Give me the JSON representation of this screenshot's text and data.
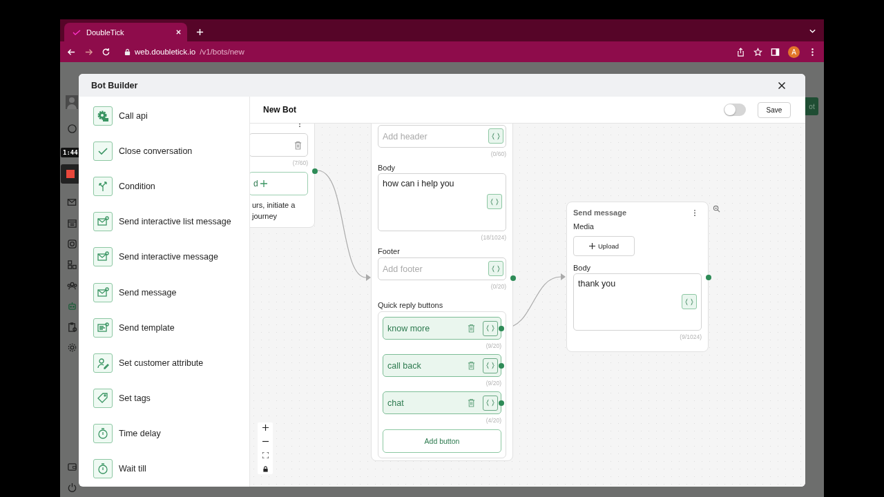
{
  "browser": {
    "tab_title": "DoubleTick",
    "url_host": "web.doubletick.io",
    "url_path": "/v1/bots/new",
    "profile_initial": "A"
  },
  "recording": {
    "time": "1:44"
  },
  "background": {
    "button_fragment": "ot"
  },
  "modal": {
    "title": "Bot Builder"
  },
  "sidebar": {
    "items": [
      {
        "label": "Call api",
        "kind": "api"
      },
      {
        "label": "Close conversation",
        "kind": "check"
      },
      {
        "label": "Condition",
        "kind": "branch"
      },
      {
        "label": "Send interactive list message",
        "kind": "mail-dot"
      },
      {
        "label": "Send interactive message",
        "kind": "mail-dot"
      },
      {
        "label": "Send message",
        "kind": "mail"
      },
      {
        "label": "Send template",
        "kind": "template"
      },
      {
        "label": "Set customer attribute",
        "kind": "person"
      },
      {
        "label": "Set tags",
        "kind": "tag"
      },
      {
        "label": "Time delay",
        "kind": "timer"
      },
      {
        "label": "Wait till",
        "kind": "timer"
      }
    ]
  },
  "editor": {
    "title": "New Bot",
    "toggle": {
      "on": false
    },
    "save": "Save"
  },
  "left_node": {
    "counter": "(7/60)",
    "button_fragment": "d",
    "text_lines": [
      "urs, initiate a",
      "journey"
    ]
  },
  "question_node": {
    "header_placeholder": "Add header",
    "header_counter": "(0/60)",
    "body_label": "Body",
    "body_value": "how can i help you",
    "body_counter": "(18/1024)",
    "footer_label": "Footer",
    "footer_placeholder": "Add footer",
    "footer_counter": "(0/20)",
    "buttons_label": "Quick reply buttons",
    "buttons": [
      {
        "label": "know more",
        "counter": "(9/20)"
      },
      {
        "label": "call back",
        "counter": "(9/20)"
      },
      {
        "label": "chat",
        "counter": "(4/20)"
      }
    ],
    "add_button": "Add button"
  },
  "message_node": {
    "title": "Send message",
    "media_label": "Media",
    "upload": "Upload",
    "body_label": "Body",
    "body_value": "thank you",
    "body_counter": "(9/1024)"
  }
}
